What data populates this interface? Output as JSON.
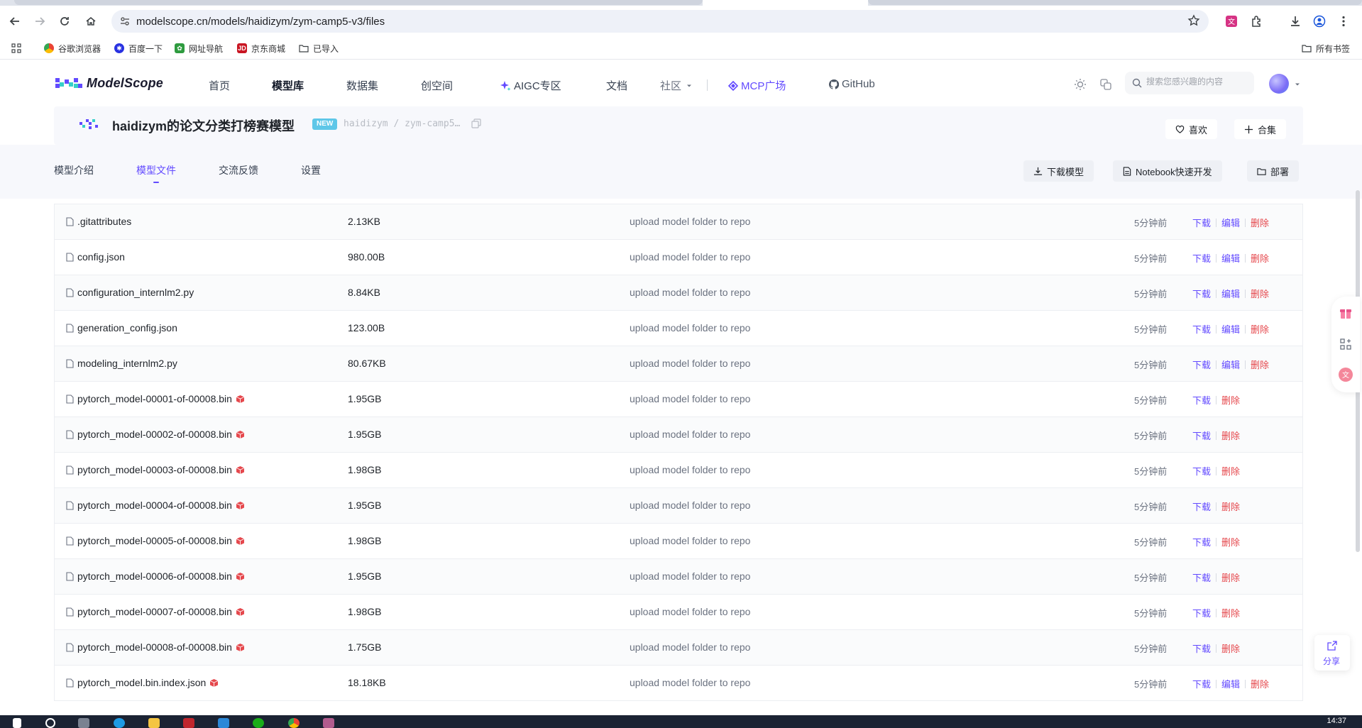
{
  "browser": {
    "url": "modelscope.cn/models/haidizym/zym-camp5-v3/files",
    "bookmarks": [
      "谷歌浏览器",
      "百度一下",
      "网址导航",
      "京东商城",
      "已导入"
    ],
    "all_bookmarks": "所有书签"
  },
  "header": {
    "logo_text": "ModelScope",
    "nav": [
      "首页",
      "模型库",
      "数据集",
      "创空间",
      "AIGC专区",
      "文档",
      "社区",
      "MCP广场",
      "GitHub"
    ],
    "active_nav": "模型库",
    "search_placeholder": "搜索您感兴趣的内容"
  },
  "model": {
    "title": "haidizym的论文分类打榜赛模型",
    "badge": "NEW",
    "path": "haidizym / zym-camp5…",
    "like_label": "喜欢",
    "collection_label": "合集"
  },
  "tabs": {
    "items": [
      "模型介绍",
      "模型文件",
      "交流反馈",
      "设置"
    ],
    "active": "模型文件",
    "download_label": "下载模型",
    "notebook_label": "Notebook快速开发",
    "deploy_label": "部署"
  },
  "files": [
    {
      "name": ".gitattributes",
      "size": "2.13KB",
      "commit": "upload model folder to repo",
      "time": "5分钟前",
      "lfs": false,
      "editable": true
    },
    {
      "name": "config.json",
      "size": "980.00B",
      "commit": "upload model folder to repo",
      "time": "5分钟前",
      "lfs": false,
      "editable": true
    },
    {
      "name": "configuration_internlm2.py",
      "size": "8.84KB",
      "commit": "upload model folder to repo",
      "time": "5分钟前",
      "lfs": false,
      "editable": true
    },
    {
      "name": "generation_config.json",
      "size": "123.00B",
      "commit": "upload model folder to repo",
      "time": "5分钟前",
      "lfs": false,
      "editable": true
    },
    {
      "name": "modeling_internlm2.py",
      "size": "80.67KB",
      "commit": "upload model folder to repo",
      "time": "5分钟前",
      "lfs": false,
      "editable": true
    },
    {
      "name": "pytorch_model-00001-of-00008.bin",
      "size": "1.95GB",
      "commit": "upload model folder to repo",
      "time": "5分钟前",
      "lfs": true,
      "editable": false
    },
    {
      "name": "pytorch_model-00002-of-00008.bin",
      "size": "1.95GB",
      "commit": "upload model folder to repo",
      "time": "5分钟前",
      "lfs": true,
      "editable": false
    },
    {
      "name": "pytorch_model-00003-of-00008.bin",
      "size": "1.98GB",
      "commit": "upload model folder to repo",
      "time": "5分钟前",
      "lfs": true,
      "editable": false
    },
    {
      "name": "pytorch_model-00004-of-00008.bin",
      "size": "1.95GB",
      "commit": "upload model folder to repo",
      "time": "5分钟前",
      "lfs": true,
      "editable": false
    },
    {
      "name": "pytorch_model-00005-of-00008.bin",
      "size": "1.98GB",
      "commit": "upload model folder to repo",
      "time": "5分钟前",
      "lfs": true,
      "editable": false
    },
    {
      "name": "pytorch_model-00006-of-00008.bin",
      "size": "1.95GB",
      "commit": "upload model folder to repo",
      "time": "5分钟前",
      "lfs": true,
      "editable": false
    },
    {
      "name": "pytorch_model-00007-of-00008.bin",
      "size": "1.98GB",
      "commit": "upload model folder to repo",
      "time": "5分钟前",
      "lfs": true,
      "editable": false
    },
    {
      "name": "pytorch_model-00008-of-00008.bin",
      "size": "1.75GB",
      "commit": "upload model folder to repo",
      "time": "5分钟前",
      "lfs": true,
      "editable": false
    },
    {
      "name": "pytorch_model.bin.index.json",
      "size": "18.18KB",
      "commit": "upload model folder to repo",
      "time": "5分钟前",
      "lfs": true,
      "editable": true
    }
  ],
  "row_actions": {
    "download": "下载",
    "edit": "编辑",
    "delete": "删除"
  },
  "share_label": "分享",
  "clock": "14:37",
  "colors": {
    "accent": "#624aff",
    "danger": "#e5484d",
    "badge": "#5ec7e8"
  }
}
